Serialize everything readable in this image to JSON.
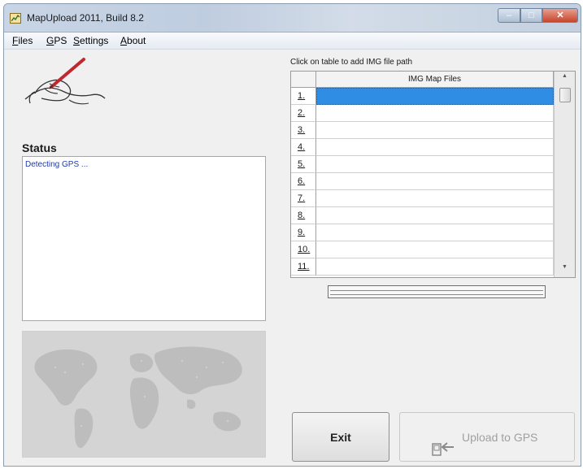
{
  "window": {
    "title": "MapUpload 2011, Build 8.2"
  },
  "menu": {
    "files": {
      "hotkey": "F",
      "rest": "iles"
    },
    "gps": {
      "hotkey": "G",
      "rest": "PS"
    },
    "settings": {
      "hotkey": "S",
      "rest": "ettings"
    },
    "about": {
      "hotkey": "A",
      "rest": "bout"
    }
  },
  "status": {
    "label": "Status",
    "text": "Detecting GPS ..."
  },
  "table": {
    "instruction": "Click on table to add IMG file path",
    "column_header": "IMG Map Files",
    "rows": [
      {
        "num": "1.",
        "value": "",
        "selected": true
      },
      {
        "num": "2.",
        "value": ""
      },
      {
        "num": "3.",
        "value": ""
      },
      {
        "num": "4.",
        "value": ""
      },
      {
        "num": "5.",
        "value": ""
      },
      {
        "num": "6.",
        "value": ""
      },
      {
        "num": "7.",
        "value": ""
      },
      {
        "num": "8.",
        "value": ""
      },
      {
        "num": "9.",
        "value": ""
      },
      {
        "num": "10.",
        "value": ""
      },
      {
        "num": "11.",
        "value": ""
      }
    ]
  },
  "buttons": {
    "exit": "Exit",
    "upload": "Upload to GPS"
  },
  "icons": {
    "signature": "hand-writing-icon",
    "upload": "device-arrow-icon",
    "app": "map-upload-app-icon"
  },
  "colors": {
    "selection": "#2f8de4",
    "status_text": "#1f3aa8",
    "disabled_text": "#a0a0a0"
  }
}
